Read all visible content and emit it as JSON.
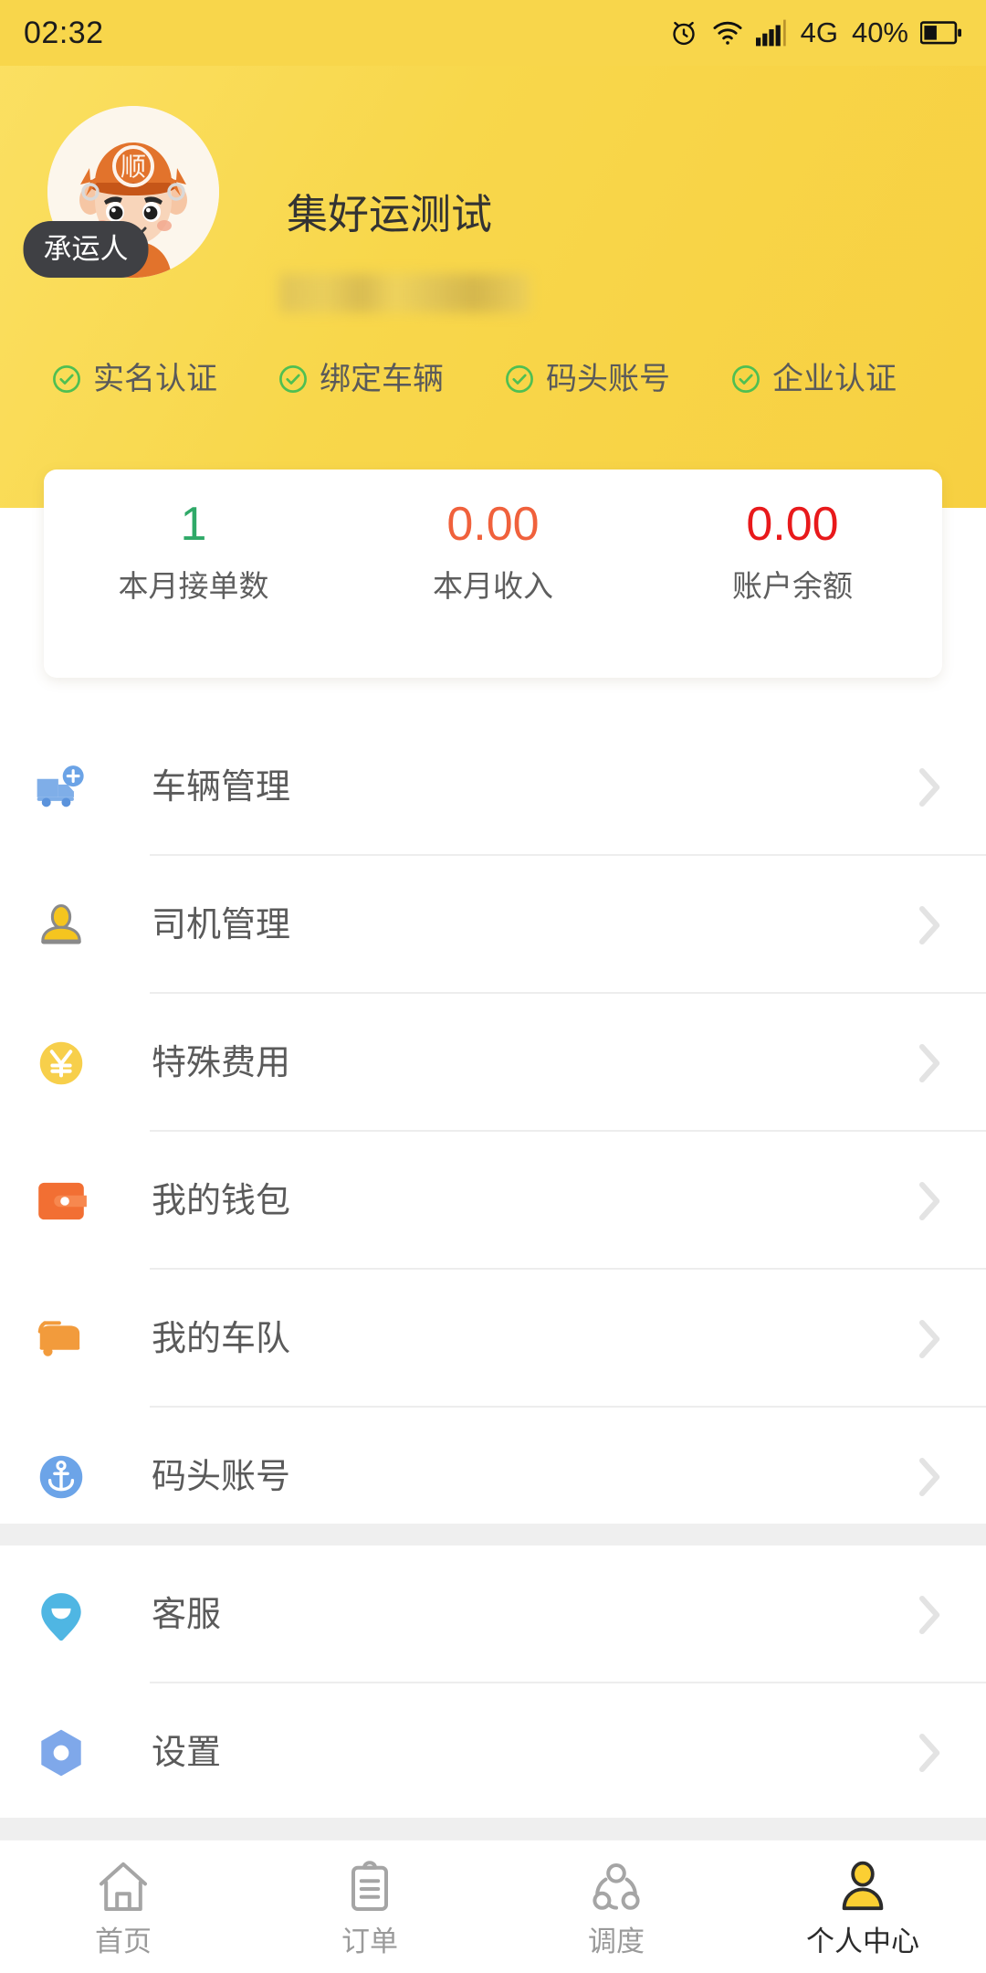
{
  "statusbar": {
    "time": "02:32",
    "battery_percent": "40%",
    "network": "4G",
    "icons": [
      "alarm-icon",
      "wifi-icon",
      "signal-icon",
      "battery-icon"
    ]
  },
  "profile": {
    "name": "集好运测试",
    "subtitle_redacted": "",
    "role_badge": "承运人",
    "avatar_icon": "courier-avatar",
    "avatar_cap_text": "顺",
    "verifications": [
      {
        "label": "实名认证",
        "icon": "check-circle-icon",
        "verified": true
      },
      {
        "label": "绑定车辆",
        "icon": "check-circle-icon",
        "verified": true
      },
      {
        "label": "码头账号",
        "icon": "check-circle-icon",
        "verified": true
      },
      {
        "label": "企业认证",
        "icon": "check-circle-icon",
        "verified": true
      }
    ]
  },
  "stats": [
    {
      "value": "1",
      "label": "本月接单数",
      "color": "#2FA968"
    },
    {
      "value": "0.00",
      "label": "本月收入",
      "color": "#F0613C"
    },
    {
      "value": "0.00",
      "label": "账户余额",
      "color": "#E8191B"
    }
  ],
  "menu_groups": [
    {
      "items": [
        {
          "label": "车辆管理",
          "icon": "truck-add-icon",
          "color": "#7FAEE8"
        },
        {
          "label": "司机管理",
          "icon": "driver-icon",
          "color": "#F5C51F"
        },
        {
          "label": "特殊费用",
          "icon": "yuan-circle-icon",
          "color": "#F7CF4B"
        },
        {
          "label": "我的钱包",
          "icon": "wallet-icon",
          "color": "#F26F33"
        },
        {
          "label": "我的车队",
          "icon": "fleet-truck-icon",
          "color": "#F29B3C"
        },
        {
          "label": "码头账号",
          "icon": "anchor-icon",
          "color": "#6CA4E8"
        }
      ]
    },
    {
      "items": [
        {
          "label": "客服",
          "icon": "support-chat-icon",
          "color": "#4FB6E3"
        },
        {
          "label": "设置",
          "icon": "settings-hex-icon",
          "color": "#7FA8EA"
        }
      ]
    }
  ],
  "tabbar": {
    "items": [
      {
        "label": "首页",
        "icon": "home-icon",
        "active": false
      },
      {
        "label": "订单",
        "icon": "order-icon",
        "active": false
      },
      {
        "label": "调度",
        "icon": "dispatch-icon",
        "active": false
      },
      {
        "label": "个人中心",
        "icon": "person-icon",
        "active": true
      }
    ]
  },
  "colors": {
    "header_yellow": "#F8D74B",
    "accent_yellow": "#FBCF33",
    "page_gray": "#EFEFEF",
    "text_primary": "#5a5a5a",
    "chevron_gray": "#E3E3E3"
  }
}
